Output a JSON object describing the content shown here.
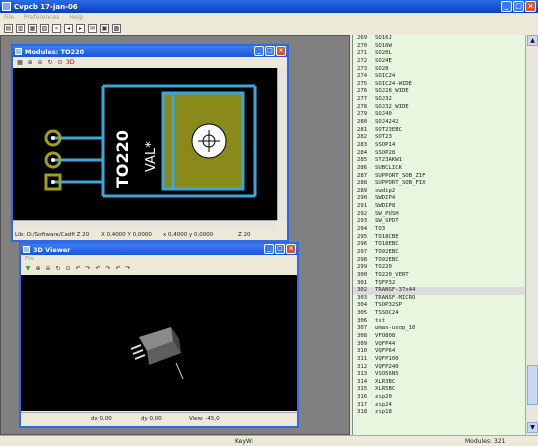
{
  "app": {
    "title": "Cvpcb 17-jan-06"
  },
  "menu": [
    "File",
    "Preferences",
    "Help"
  ],
  "toolbar_icons": [
    "open-icon",
    "save-icon",
    "config-icon",
    "view-module-icon",
    "first-icon",
    "prev-icon",
    "next-icon",
    "find-icon",
    "delete-icon",
    "doc-icon"
  ],
  "module_window": {
    "title": "Modules: TO220",
    "footprint_name": "TO220",
    "value_label": "VAL*",
    "status": {
      "lib": "Lib: O:/Software/Cadfi Z 20",
      "xy": "X 0,4000  Y 0,0000",
      "dxy": "x 0,4000  y 0,0000",
      "zoom": "Z 20"
    }
  },
  "viewer_window": {
    "title": "3D Viewer",
    "menu": "File",
    "status": {
      "dx": "dx 0,00",
      "dy": "dy 0,00",
      "view": "View: -45,0"
    }
  },
  "list": {
    "start": 269,
    "selected_index": 302,
    "items": [
      "SO16J",
      "SO16W",
      "SO20L",
      "SO24E",
      "SO28",
      "SOIC24",
      "SOIC24-WIDE",
      "SOJ28_WIDE",
      "SOJ32",
      "SOJ32_WIDE",
      "SOJ40",
      "SOJ4242",
      "SOT23EBC",
      "SOT23",
      "SSOP14",
      "SSOP28",
      "ST23AKW1",
      "SUBCLICK",
      "SUPPORT_SOB_ZIF",
      "SUPPORT_SOB_FIX",
      "swdip2",
      "SWDIP4",
      "SWDIP8",
      "SW_PUSH",
      "SW_SPDT",
      "TO3",
      "TO18CBE",
      "TO18EBC",
      "TO92EBC",
      "TO92EBC",
      "TO220",
      "TO220_VERT",
      "TQFP32",
      "TRANSF-37x44",
      "TRANSF-MICRO",
      "TSOP32SP",
      "TSSOC24",
      "tst",
      "umax-usop_10",
      "VFO808",
      "VQFP44",
      "VQFP64",
      "VQFP100",
      "VQFP240",
      "VSO56N5",
      "XLR3BC",
      "XLR5BC",
      "zip20",
      "zip24",
      "zip18"
    ]
  },
  "statusbar": {
    "center": "KeyW:",
    "right": "Modules: 321"
  }
}
